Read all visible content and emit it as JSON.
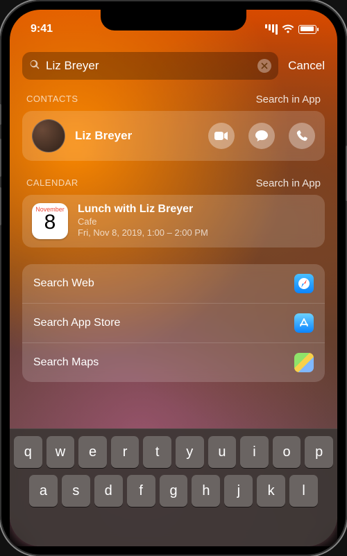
{
  "status": {
    "time": "9:41"
  },
  "search": {
    "query": "Liz Breyer",
    "placeholder": "Search",
    "cancel": "Cancel"
  },
  "sections": {
    "contacts": {
      "heading": "CONTACTS",
      "link": "Search in App"
    },
    "calendar": {
      "heading": "CALENDAR",
      "link": "Search in App"
    }
  },
  "contact": {
    "name": "Liz Breyer",
    "actions": [
      "video-icon",
      "message-icon",
      "phone-icon"
    ]
  },
  "event": {
    "month": "November",
    "day": "8",
    "title": "Lunch with Liz Breyer",
    "location": "Cafe",
    "datetime": "Fri, Nov 8, 2019, 1:00 – 2:00 PM"
  },
  "searchOptions": [
    {
      "label": "Search Web",
      "icon": "safari"
    },
    {
      "label": "Search App Store",
      "icon": "appstore"
    },
    {
      "label": "Search Maps",
      "icon": "maps"
    }
  ],
  "keyboard": {
    "row1": [
      "q",
      "w",
      "e",
      "r",
      "t",
      "y",
      "u",
      "i",
      "o",
      "p"
    ],
    "row2": [
      "a",
      "s",
      "d",
      "f",
      "g",
      "h",
      "j",
      "k",
      "l"
    ]
  }
}
